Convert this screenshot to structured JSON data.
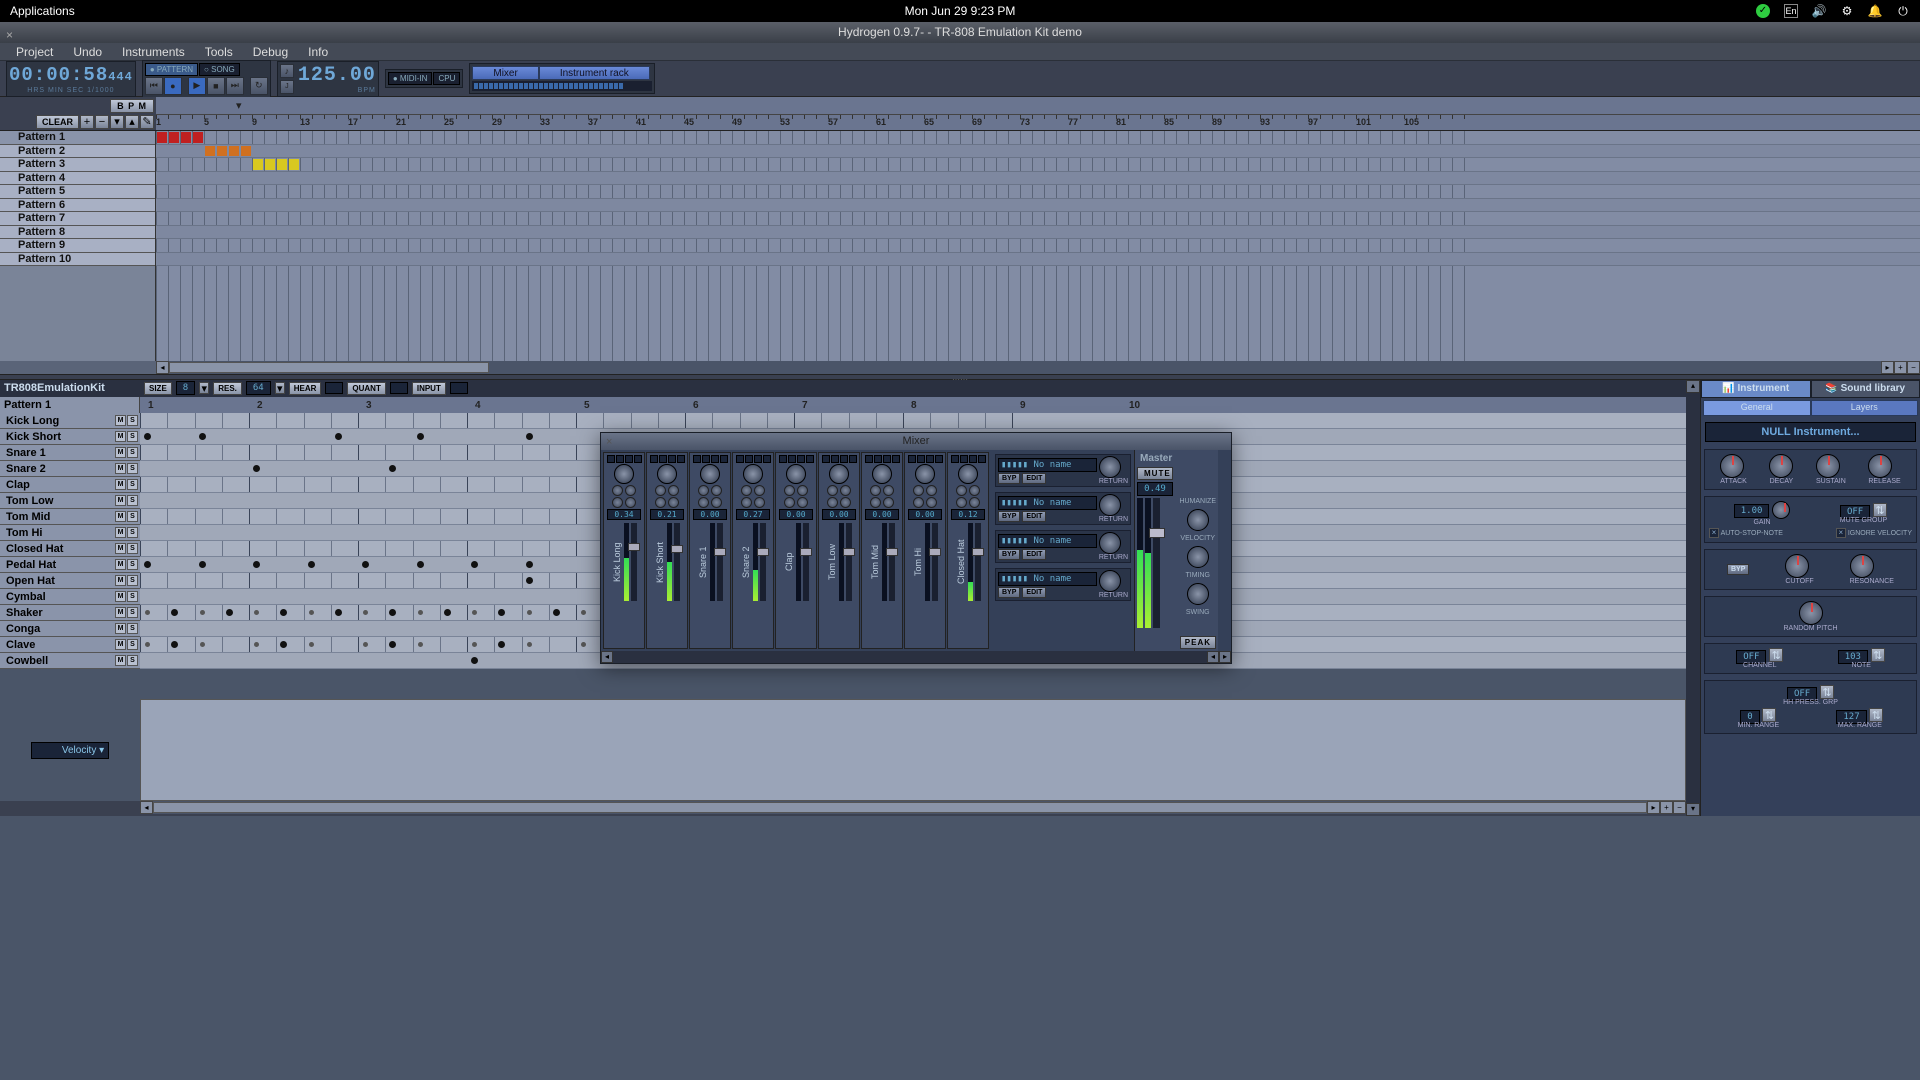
{
  "system": {
    "applications": "Applications",
    "datetime": "Mon Jun 29   9:23 PM",
    "lang": "En"
  },
  "window": {
    "title": "Hydrogen 0.9.7- - TR-808 Emulation Kit demo"
  },
  "menu": [
    "Project",
    "Undo",
    "Instruments",
    "Tools",
    "Debug",
    "Info"
  ],
  "transport": {
    "time": "00:00:58",
    "ms": "444",
    "labels": "HRS     MIN      SEC   1/1000",
    "mode_pattern": "PATTERN",
    "mode_song": "SONG",
    "bpm": "125.00",
    "bpm_label": "BPM",
    "midi": "MIDI-IN",
    "cpu": "CPU",
    "mixer_btn": "Mixer",
    "rack_btn": "Instrument rack"
  },
  "song": {
    "bpm_btn": "B P M",
    "clear_btn": "CLEAR",
    "patterns": [
      "Pattern 1",
      "Pattern 2",
      "Pattern 3",
      "Pattern 4",
      "Pattern 5",
      "Pattern 6",
      "Pattern 7",
      "Pattern 8",
      "Pattern 9",
      "Pattern 10"
    ],
    "ruler": [
      1,
      5,
      9,
      13,
      17,
      21,
      25,
      29,
      33,
      37,
      41,
      45,
      49,
      53,
      57,
      61,
      65,
      69,
      73,
      77,
      81,
      85,
      89,
      93,
      97,
      101,
      105
    ],
    "blocks": [
      {
        "row": 0,
        "start": 0,
        "len": 4,
        "color": "#c02020"
      },
      {
        "row": 1,
        "start": 4,
        "len": 4,
        "color": "#d07020"
      },
      {
        "row": 2,
        "start": 8,
        "len": 4,
        "color": "#d8c820"
      }
    ]
  },
  "pattern": {
    "kit": "TR808EmulationKit",
    "name": "Pattern 1",
    "size_lbl": "SIZE",
    "size": "8",
    "res_lbl": "RES.",
    "res": "64",
    "hear_lbl": "HEAR",
    "quant_lbl": "QUANT",
    "input_lbl": "INPUT",
    "beat_nums": [
      1,
      2,
      3,
      4,
      5,
      6,
      7,
      8,
      9,
      10
    ],
    "instruments": [
      "Kick Long",
      "Kick Short",
      "Snare 1",
      "Snare 2",
      "Clap",
      "Tom Low",
      "Tom Mid",
      "Tom Hi",
      "Closed Hat",
      "Pedal Hat",
      "Open Hat",
      "Cymbal",
      "Shaker",
      "Conga",
      "Clave",
      "Cowbell"
    ],
    "notes": {
      "1": [
        0,
        1,
        3.5,
        5,
        7
      ],
      "3": [
        2,
        4.5
      ],
      "9": [
        0,
        1,
        2,
        3,
        4,
        5,
        6,
        7
      ],
      "10": [
        7
      ],
      "12": [
        0.5,
        1.5,
        2.5,
        3.5,
        4.5,
        5.5,
        6.5,
        7.5
      ],
      "14": [
        0.5,
        2.5,
        4.5,
        6.5
      ],
      "15": [
        6
      ]
    },
    "velocity_label": "Velocity"
  },
  "inst_panel": {
    "tab1": "Instrument",
    "tab2": "Sound library",
    "stab1": "General",
    "stab2": "Layers",
    "name": "NULL Instrument...",
    "adsr": [
      "ATTACK",
      "DECAY",
      "SUSTAIN",
      "RELEASE"
    ],
    "gain_val": "1.00",
    "gain_lbl": "GAIN",
    "mg_val": "OFF",
    "mg_lbl": "MUTE GROUP",
    "auto_stop": "AUTO-STOP-NOTE",
    "ignore_vel": "IGNORE VELOCITY",
    "byp": "BYP",
    "cutoff": "CUTOFF",
    "resonance": "RESONANCE",
    "random_pitch": "RANDOM PITCH",
    "ch_val": "OFF",
    "ch_lbl": "CHANNEL",
    "note_val": "103",
    "note_lbl": "NOTE",
    "hh_val": "OFF",
    "hh_lbl": "HH PRESS. GRP",
    "min_val": "0",
    "min_lbl": "MIN. RANGE",
    "max_val": "127",
    "max_lbl": "MAX. RANGE"
  },
  "mixer": {
    "title": "Mixer",
    "master": "Master",
    "mute": "MUTE",
    "master_val": "0.49",
    "peak": "PEAK",
    "humanize": "HUMANIZE",
    "velocity": "VELOCITY",
    "timing": "TIMING",
    "swing": "SWING",
    "byp": "BYP",
    "edit": "EDIT",
    "return": "RETURN",
    "fx_name": "No name",
    "channels": [
      {
        "name": "Kick Long",
        "val": "0.34",
        "fader": 20,
        "vu": 55
      },
      {
        "name": "Kick Short",
        "val": "0.21",
        "fader": 22,
        "vu": 50
      },
      {
        "name": "Snare 1",
        "val": "0.00",
        "fader": 25,
        "vu": 0
      },
      {
        "name": "Snare 2",
        "val": "0.27",
        "fader": 25,
        "vu": 40
      },
      {
        "name": "Clap",
        "val": "0.00",
        "fader": 25,
        "vu": 0
      },
      {
        "name": "Tom Low",
        "val": "0.00",
        "fader": 25,
        "vu": 0
      },
      {
        "name": "Tom Mid",
        "val": "0.00",
        "fader": 25,
        "vu": 0
      },
      {
        "name": "Tom Hi",
        "val": "0.00",
        "fader": 25,
        "vu": 0
      },
      {
        "name": "Closed Hat",
        "val": "0.12",
        "fader": 25,
        "vu": 25
      }
    ]
  }
}
